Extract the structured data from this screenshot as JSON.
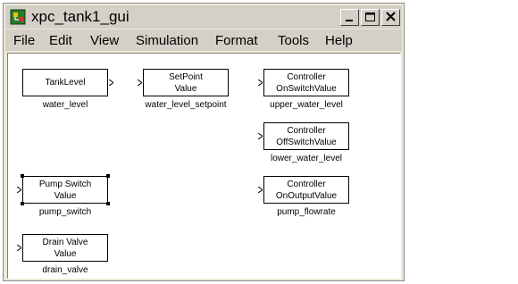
{
  "window": {
    "title": "xpc_tank1_gui",
    "minimize_label": "_",
    "maximize_label": "□",
    "close_label": "✕"
  },
  "menu": [
    "File",
    "Edit",
    "View",
    "Simulation",
    "Format",
    "Tools",
    "Help"
  ],
  "blocks": [
    {
      "line1": "TankLevel",
      "line2": "",
      "label": "water_level"
    },
    {
      "line1": "SetPoint",
      "line2": "Value",
      "label": "water_level_setpoint"
    },
    {
      "line1": "Controller",
      "line2": "OnSwitchValue",
      "label": "upper_water_level"
    },
    {
      "line1": "Controller",
      "line2": "OffSwitchValue",
      "label": "lower_water_level"
    },
    {
      "line1": "Pump Switch",
      "line2": "Value",
      "label": "pump_switch"
    },
    {
      "line1": "Controller",
      "line2": "OnOutputValue",
      "label": "pump_flowrate"
    },
    {
      "line1": "Drain Valve",
      "line2": "Value",
      "label": "drain_valve"
    }
  ]
}
